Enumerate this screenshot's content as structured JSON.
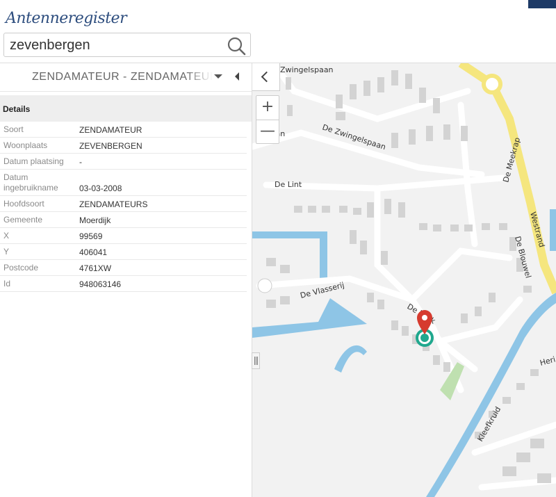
{
  "app": {
    "title": "Antenneregister"
  },
  "search": {
    "value": "zevenbergen",
    "icon": "search-icon"
  },
  "panel": {
    "title": "ZENDAMATEUR - ZENDAMATEURS",
    "section": "Details",
    "rows": [
      {
        "key": "Soort",
        "value": "ZENDAMATEUR"
      },
      {
        "key": "Woonplaats",
        "value": "ZEVENBERGEN"
      },
      {
        "key": "Datum plaatsing",
        "value": "-"
      },
      {
        "key": "Datum ingebruikname",
        "value": "03-03-2008"
      },
      {
        "key": "Hoofdsoort",
        "value": "ZENDAMATEURS"
      },
      {
        "key": "Gemeente",
        "value": "Moerdijk"
      },
      {
        "key": "X",
        "value": "99569"
      },
      {
        "key": "Y",
        "value": "406041"
      },
      {
        "key": "Postcode",
        "value": "4761XW"
      },
      {
        "key": "Id",
        "value": "948063146"
      }
    ]
  },
  "map": {
    "zoom_in": "+",
    "zoom_out": "—",
    "streets": {
      "zwingelspaan_top": "Zwingelspaan",
      "zwingelspaan_left": "spaan",
      "de_zwingelspaan": "De Zwingelspaan",
      "de_lint": "De Lint",
      "de_meekrap": "De Meekrap",
      "westrand": "Westrand",
      "de_blouwel": "De Blouwel",
      "de_vlasserij": "De Vlasserij",
      "de_b": "De B",
      "de_b_tail": "k",
      "kleefkruid": "Kleefkruid",
      "heri": "Heri"
    },
    "colors": {
      "water": "#8ec5e6",
      "road_main": "#f5e67e",
      "building": "#d3d3d3",
      "marker": "#d63b2f",
      "antenna": "#20a88e"
    }
  }
}
